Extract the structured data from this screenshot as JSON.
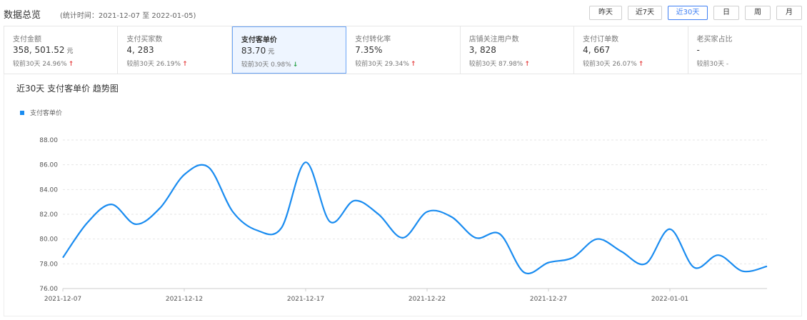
{
  "header": {
    "title": "数据总览",
    "period": "(统计时间：2021-12-07 至 2022-01-05)"
  },
  "range_buttons": [
    {
      "label": "昨天",
      "active": false
    },
    {
      "label": "近7天",
      "active": false
    },
    {
      "label": "近30天",
      "active": true
    },
    {
      "label": "日",
      "active": false
    },
    {
      "label": "周",
      "active": false
    },
    {
      "label": "月",
      "active": false
    }
  ],
  "metrics": [
    {
      "label": "支付金额",
      "value": "358, 501.52",
      "unit": "元",
      "compare": "较前30天",
      "change": "24.96%",
      "trend": "up"
    },
    {
      "label": "支付买家数",
      "value": "4, 283",
      "unit": "",
      "compare": "较前30天",
      "change": "26.19%",
      "trend": "up"
    },
    {
      "label": "支付客单价",
      "value": "83.70",
      "unit": "元",
      "compare": "较前30天",
      "change": "0.98%",
      "trend": "down"
    },
    {
      "label": "支付转化率",
      "value": "7.35%",
      "unit": "",
      "compare": "较前30天",
      "change": "29.34%",
      "trend": "up"
    },
    {
      "label": "店铺关注用户数",
      "value": "3, 828",
      "unit": "",
      "compare": "较前30天",
      "change": "87.98%",
      "trend": "up"
    },
    {
      "label": "支付订单数",
      "value": "4, 667",
      "unit": "",
      "compare": "较前30天",
      "change": "26.07%",
      "trend": "up"
    },
    {
      "label": "老买家占比",
      "value": "-",
      "unit": "",
      "compare": "较前30天",
      "change": "-",
      "trend": "none"
    }
  ],
  "chart_panel": {
    "title": "近30天 支付客单价 趋势图"
  },
  "colors": {
    "accent": "#3f7ff3",
    "series": "#1a8cf0",
    "up": "#e64545",
    "down": "#2aa44a"
  },
  "chart_data": {
    "type": "line",
    "title": "近30天 支付客单价 趋势图",
    "xlabel": "",
    "ylabel": "",
    "ylim": [
      76,
      88
    ],
    "y_ticks": [
      "76.00",
      "78.00",
      "80.00",
      "82.00",
      "84.00",
      "86.00",
      "88.00"
    ],
    "x_tick_labels": [
      "2021-12-07",
      "2021-12-12",
      "2021-12-17",
      "2021-12-22",
      "2021-12-27",
      "2022-01-01"
    ],
    "x_tick_indices": [
      0,
      5,
      10,
      15,
      20,
      25
    ],
    "grid": true,
    "legend": "top-left",
    "x": [
      "2021-12-07",
      "2021-12-08",
      "2021-12-09",
      "2021-12-10",
      "2021-12-11",
      "2021-12-12",
      "2021-12-13",
      "2021-12-14",
      "2021-12-15",
      "2021-12-16",
      "2021-12-17",
      "2021-12-18",
      "2021-12-19",
      "2021-12-20",
      "2021-12-21",
      "2021-12-22",
      "2021-12-23",
      "2021-12-24",
      "2021-12-25",
      "2021-12-26",
      "2021-12-27",
      "2021-12-28",
      "2021-12-29",
      "2021-12-30",
      "2021-12-31",
      "2022-01-01",
      "2022-01-02",
      "2022-01-03",
      "2022-01-04",
      "2022-01-05"
    ],
    "series": [
      {
        "name": "支付客单价",
        "values": [
          78.5,
          81.3,
          82.8,
          81.2,
          82.5,
          85.2,
          85.8,
          82.2,
          80.7,
          80.9,
          86.2,
          81.4,
          83.1,
          82.0,
          80.1,
          82.2,
          81.8,
          80.1,
          80.4,
          77.3,
          78.1,
          78.5,
          80.0,
          79.0,
          78.0,
          80.8,
          77.7,
          78.7,
          77.4,
          77.8
        ]
      }
    ]
  }
}
